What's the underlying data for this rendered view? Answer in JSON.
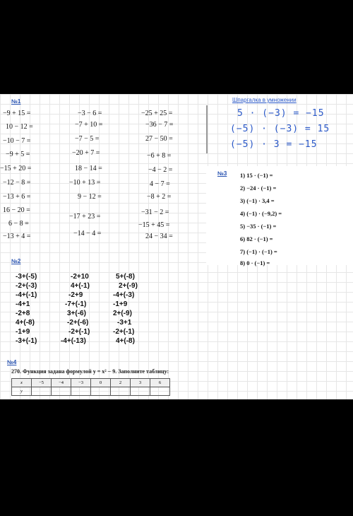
{
  "task1": {
    "header": "№1",
    "columns": [
      [
        "−9 + 15 =",
        "10 − 12 =",
        "−10 − 7 =",
        "−9 + 5 =",
        "−15 + 20 =",
        "−12 − 8 =",
        "−13 + 6 =",
        "16 − 20 =",
        "6 − 8 =",
        "−13 + 4 ="
      ],
      [
        "−3 − 6 =",
        "−7 + 10 =",
        "−7 − 5 =",
        "−20 + 7 =",
        "18 − 14 =",
        "−10 + 13 =",
        "9 − 12 =",
        "−17 + 23 =",
        "−14 − 4 ="
      ],
      [
        "−25 + 25 =",
        "−36 − 7 =",
        "27 − 50 =",
        "−6 + 8 =",
        "−4 − 2 =",
        "4 − 7 =",
        "−8 + 2 =",
        "−31 − 2 =",
        "−15 + 45 =",
        "24 − 34 ="
      ]
    ]
  },
  "cheatsheet": {
    "title": "Шпаргалка в умножении",
    "lines": [
      "5 · (−3) = −15",
      "(−5) · (−3) = 15",
      "(−5) · 3 = −15"
    ]
  },
  "task3": {
    "header": "№3",
    "rows": [
      "1)   15 · (−1)  =",
      "2)   −24 · (−1)  =",
      "3)   (−1) · 3,4  =",
      "4)   (−1) · (−9,2) =",
      "5)   −35 · (−1)  =",
      "6)   82 · (−1)  =",
      "7)   (−1) · (−1)  =",
      "8)   0 · (−1)  ="
    ]
  },
  "task2": {
    "header": "№2",
    "columns": [
      [
        "-3+(-5)",
        "-2+(-3)",
        "-4+(-1)",
        "-4+1",
        "-2+8",
        "4+(-8)",
        "-1+9",
        "-3+(-1)"
      ],
      [
        "-2+10",
        "4+(-1)",
        "-2+9",
        "-7+(-1)",
        "3+(-6)",
        "-2+(-6)",
        "-2+(-1)",
        "-4+(-13)"
      ],
      [
        "5+(-8)",
        "2+(-9)",
        "-4+(-3)",
        "-1+9",
        "2+(-9)",
        "-3+1",
        "-2+(-1)",
        "4+(-8)"
      ]
    ]
  },
  "task4": {
    "header": "№4",
    "problem": "270.  Функция задана формулой  y = x² − 9.  Заполните таблицу:",
    "table": {
      "x_label": "x",
      "y_label": "y",
      "x_values": [
        "−5",
        "−4",
        "−3",
        "0",
        "2",
        "3",
        "6"
      ]
    }
  }
}
